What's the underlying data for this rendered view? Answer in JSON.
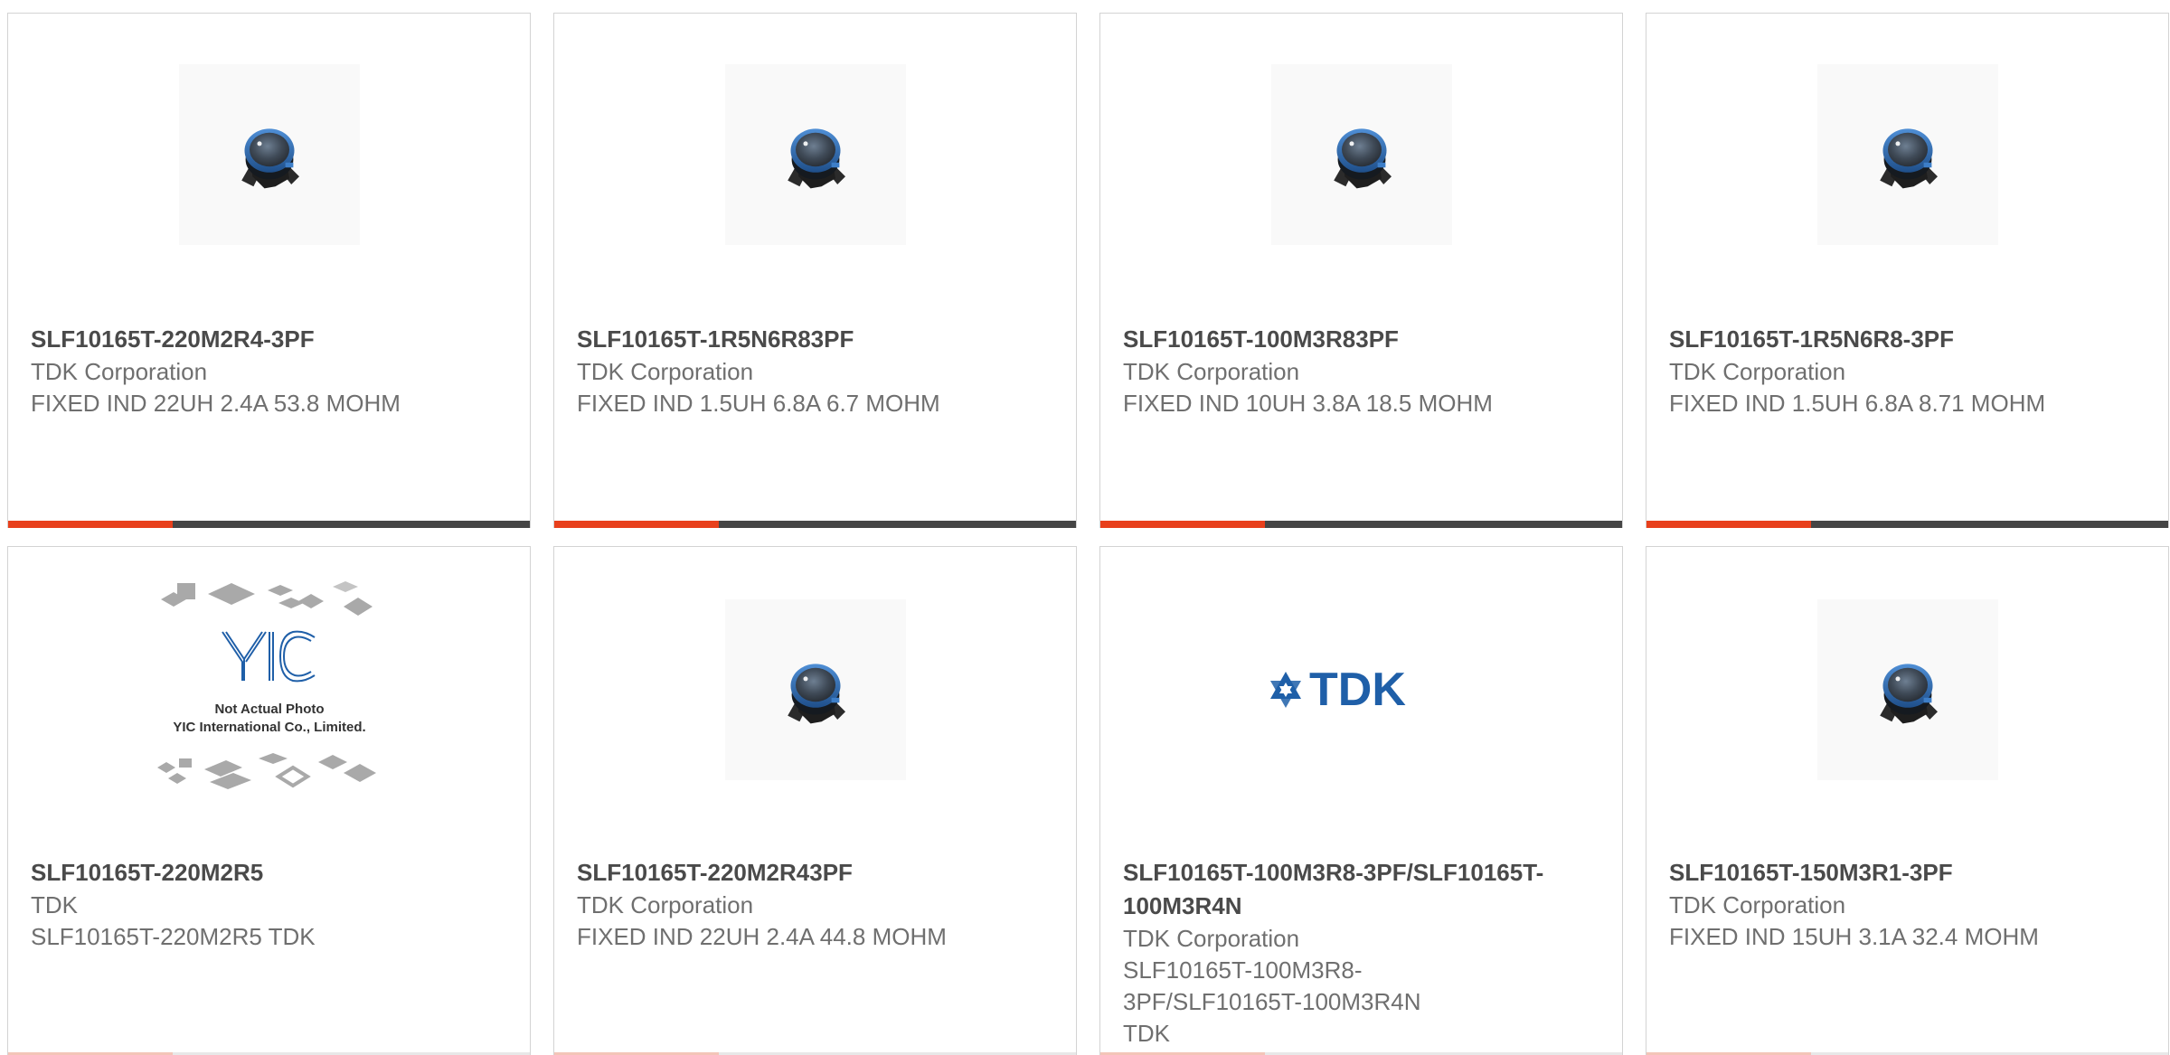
{
  "products": [
    {
      "title": "SLF10165T-220M2R4-3PF",
      "manufacturer": "TDK Corporation",
      "description": "FIXED IND 22UH 2.4A 53.8 MOHM",
      "image": "inductor-photo"
    },
    {
      "title": "SLF10165T-1R5N6R83PF",
      "manufacturer": "TDK Corporation",
      "description": "FIXED IND 1.5UH 6.8A 6.7 MOHM",
      "image": "inductor-photo"
    },
    {
      "title": "SLF10165T-100M3R83PF",
      "manufacturer": "TDK Corporation",
      "description": "FIXED IND 10UH 3.8A 18.5 MOHM",
      "image": "inductor-photo"
    },
    {
      "title": "SLF10165T-1R5N6R8-3PF",
      "manufacturer": "TDK Corporation",
      "description": "FIXED IND 1.5UH 6.8A 8.71 MOHM",
      "image": "inductor-photo"
    },
    {
      "title": "SLF10165T-220M2R5",
      "manufacturer": "TDK",
      "description": "SLF10165T-220M2R5 TDK",
      "image": "placeholder-photo",
      "placeholder_line1": "Not Actual Photo",
      "placeholder_line2": "YIC International Co., Limited.",
      "placeholder_logo": "YIC"
    },
    {
      "title": "SLF10165T-220M2R43PF",
      "manufacturer": "TDK Corporation",
      "description": "FIXED IND 22UH 2.4A 44.8 MOHM",
      "image": "inductor-photo"
    },
    {
      "title": "SLF10165T-100M3R8-3PF/SLF10165T-100M3R4N",
      "manufacturer": "TDK Corporation",
      "description": "SLF10165T-100M3R8-3PF/SLF10165T-100M3R4N TDK",
      "image": "brand-logo",
      "logo_text": "TDK"
    },
    {
      "title": "SLF10165T-150M3R1-3PF",
      "manufacturer": "TDK Corporation",
      "description": "FIXED IND 15UH 3.1A 32.4 MOHM",
      "image": "inductor-photo"
    }
  ],
  "colors": {
    "accent": "#e8401c",
    "bar": "#454545",
    "title": "#4a4a4a",
    "text": "#6f6f6f",
    "border": "#d3d3d3",
    "logo_blue": "#1f5fa8"
  }
}
